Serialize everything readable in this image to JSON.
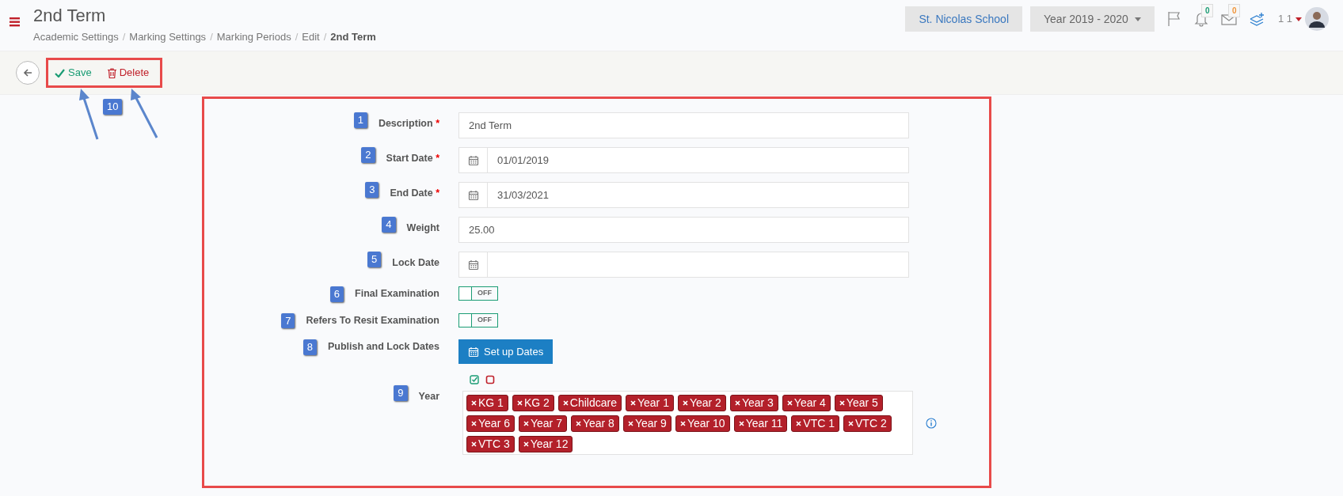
{
  "header": {
    "title": "2nd Term",
    "breadcrumb": [
      {
        "label": "Academic Settings",
        "separator": "/"
      },
      {
        "label": "Marking Settings",
        "separator": "/"
      },
      {
        "label": "Marking Periods",
        "separator": "/"
      },
      {
        "label": "Edit",
        "separator": "/"
      },
      {
        "label": "2nd Term"
      }
    ],
    "school": "St. Nicolas School",
    "year_selector": "Year 2019 - 2020",
    "notifications": [
      {
        "kind": "bell",
        "count": "0",
        "color": "#1a9c74"
      },
      {
        "kind": "mail",
        "count": "0",
        "color": "#f0953a"
      }
    ],
    "user": "1 1"
  },
  "toolbar": {
    "buttons": [
      {
        "kind": "save",
        "label": "Save"
      },
      {
        "kind": "delete",
        "label": "Delete"
      }
    ],
    "annotation": "10"
  },
  "form": {
    "fields": [
      {
        "kind": "text",
        "number": "1",
        "label": "Description",
        "required_mark": "*",
        "value": "2nd Term"
      },
      {
        "kind": "date",
        "number": "2",
        "label": "Start Date",
        "required_mark": "*",
        "value": "01/01/2019"
      },
      {
        "kind": "date",
        "number": "3",
        "label": "End Date",
        "required_mark": "*",
        "value": "31/03/2021"
      },
      {
        "kind": "text",
        "number": "4",
        "label": "Weight",
        "value": "25.00"
      },
      {
        "kind": "date",
        "number": "5",
        "label": "Lock Date"
      },
      {
        "kind": "toggle",
        "number": "6",
        "label": "Final Examination",
        "on": false,
        "state_text": "OFF"
      },
      {
        "kind": "toggle",
        "number": "7",
        "label": "Refers To Resit Examination",
        "on": false,
        "state_text": "OFF"
      },
      {
        "kind": "button",
        "number": "8",
        "label": "Publish and Lock Dates",
        "button": "Set up Dates"
      }
    ],
    "year": {
      "number": "9",
      "label": "Year",
      "tags": [
        "KG 1",
        "KG 2",
        "Childcare",
        "Year 1",
        "Year 2",
        "Year 3",
        "Year 4",
        "Year 5",
        "Year 6",
        "Year 7",
        "Year 8",
        "Year 9",
        "Year 10",
        "Year 11",
        "VTC 1",
        "VTC 2",
        "VTC 3",
        "Year 12"
      ]
    }
  }
}
